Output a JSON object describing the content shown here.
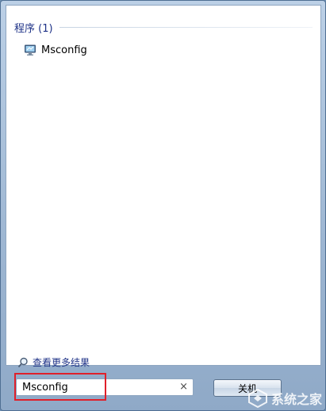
{
  "results": {
    "group_title": "程序 (1)",
    "items": [
      {
        "label": "Msconfig",
        "icon": "msconfig-monitor-icon"
      }
    ],
    "see_more_label": "查看更多结果"
  },
  "search": {
    "value": "Msconfig",
    "clear_glyph": "×"
  },
  "power": {
    "label": "关机"
  },
  "watermark": {
    "text": "系统之家"
  },
  "colors": {
    "frame": "#9db6d2",
    "group_title": "#1e3287",
    "highlight": "#e0202a"
  }
}
